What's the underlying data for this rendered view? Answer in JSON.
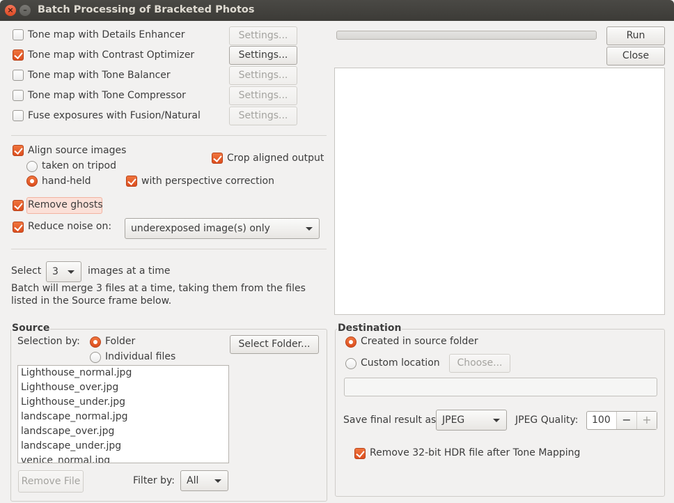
{
  "window": {
    "title": "Batch Processing of Bracketed Photos"
  },
  "methods": [
    {
      "label": "Tone map with Details Enhancer",
      "checked": false,
      "settings": "Settings...",
      "enabled": false
    },
    {
      "label": "Tone map with Contrast Optimizer",
      "checked": true,
      "settings": "Settings...",
      "enabled": true
    },
    {
      "label": "Tone map with Tone Balancer",
      "checked": false,
      "settings": "Settings...",
      "enabled": false
    },
    {
      "label": "Tone map with Tone Compressor",
      "checked": false,
      "settings": "Settings...",
      "enabled": false
    },
    {
      "label": "Fuse exposures with Fusion/Natural",
      "checked": false,
      "settings": "Settings...",
      "enabled": false
    }
  ],
  "align": {
    "label": "Align source images",
    "tripod": "taken on tripod",
    "handheld": "hand-held",
    "crop": "Crop aligned output",
    "perspective": "with perspective correction"
  },
  "ghosts": {
    "label": "Remove ghosts"
  },
  "noise": {
    "label": "Reduce noise on:",
    "option": "underexposed image(s) only"
  },
  "select": {
    "prefix": "Select",
    "count": "3",
    "suffix": "images at a time",
    "note": "Batch will merge 3 files at a time, taking them from the files listed in the Source frame below."
  },
  "actions": {
    "run": "Run",
    "close": "Close"
  },
  "source": {
    "title": "Source",
    "selection_by": "Selection by:",
    "folder": "Folder",
    "individual": "Individual files",
    "select_folder": "Select Folder...",
    "files": [
      "Lighthouse_normal.jpg",
      "Lighthouse_over.jpg",
      "Lighthouse_under.jpg",
      "landscape_normal.jpg",
      "landscape_over.jpg",
      "landscape_under.jpg",
      "venice_normal.jpg"
    ],
    "remove_file": "Remove File",
    "filter_by": "Filter by:",
    "filter_value": "All"
  },
  "destination": {
    "title": "Destination",
    "created_in_source": "Created in source folder",
    "custom_location": "Custom location",
    "choose": "Choose...",
    "path_value": "",
    "save_as": "Save final result as",
    "format": "JPEG",
    "quality_label": "JPEG Quality:",
    "quality": "100",
    "quality_minus": "−",
    "quality_plus": "+",
    "remove_hdr": "Remove 32-bit HDR file after Tone Mapping"
  },
  "colors": {
    "accent": "#e05a2a",
    "window_bg": "#f2f1f0",
    "titlebar": "#3c3b37"
  }
}
